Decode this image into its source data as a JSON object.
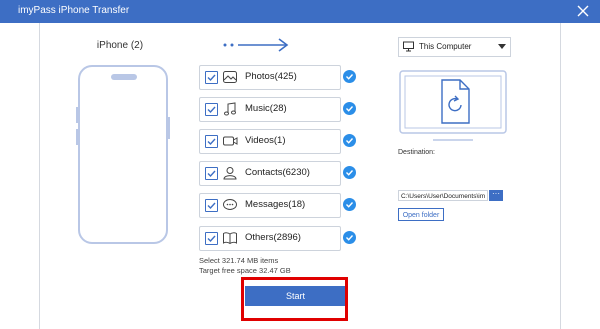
{
  "window": {
    "title": "imyPass iPhone Transfer"
  },
  "source": {
    "device_label": "iPhone (2)"
  },
  "items": [
    {
      "label": "Photos(425)",
      "icon": "photo-icon",
      "checked": true
    },
    {
      "label": "Music(28)",
      "icon": "music-icon",
      "checked": true
    },
    {
      "label": "Videos(1)",
      "icon": "video-icon",
      "checked": true
    },
    {
      "label": "Contacts(6230)",
      "icon": "contacts-icon",
      "checked": true
    },
    {
      "label": "Messages(18)",
      "icon": "messages-icon",
      "checked": true
    },
    {
      "label": "Others(2896)",
      "icon": "book-icon",
      "checked": true
    }
  ],
  "summary": {
    "selected": "Select 321.74 MB items",
    "free_space": "Target free space 32.47 GB"
  },
  "start_button": {
    "label": "Start"
  },
  "destination": {
    "device": "This Computer",
    "label": "Destination:",
    "path": "C:\\Users\\User\\Documents\\im",
    "browse_label": "···",
    "open_folder_label": "Open folder"
  },
  "colors": {
    "accent": "#3d6ec4",
    "highlight": "#e00000",
    "check": "#2b8ee8",
    "outline": "#b9c7e6"
  }
}
